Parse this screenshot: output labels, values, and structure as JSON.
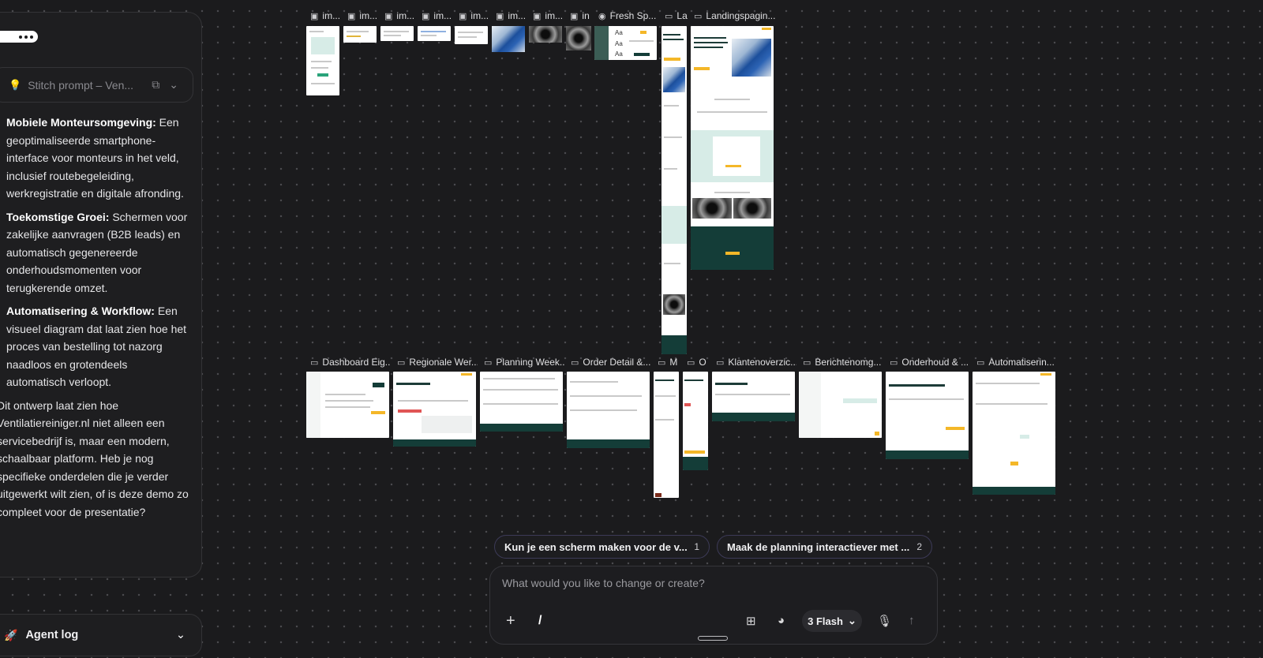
{
  "chat": {
    "prompt_chip": "Stitch prompt – Ven...",
    "paragraphs": [
      {
        "title": "Mobiele Monteursomgeving:",
        "body": " Een geoptimaliseerde smartphone-interface voor monteurs in het veld, inclusief routebegeleiding, werkregistratie en digitale afronding."
      },
      {
        "title": "Toekomstige Groei:",
        "body": " Schermen voor zakelijke aanvragen (B2B leads) en automatisch gegenereerde onderhoudsmomenten voor terugkerende omzet."
      },
      {
        "title": "Automatisering & Workflow:",
        "body": " Een visueel diagram dat laat zien hoe het proces van bestelling tot nazorg naadloos en grotendeels automatisch verloopt."
      }
    ],
    "closing": "Dit ontwerp laat zien hoe Ventilatiereiniger.nl niet alleen een servicebedrijf is, maar een modern, schaalbaar platform. Heb je nog specifieke onderdelen die je verder uitgewerkt wilt zien, of is deze demo zo compleet voor de presentatie?",
    "agent_log": "Agent log"
  },
  "canvas": {
    "top_labels": [
      "im...",
      "im...",
      "im...",
      "im...",
      "im...",
      "im...",
      "im...",
      "in",
      "Fresh Sp...",
      "La",
      "Landingspagin..."
    ],
    "bottom_labels": [
      "Dashboard Eig...",
      "Regionale Wer...",
      "Planning Week...",
      "Order Detail &...",
      "M",
      "O",
      "Klantenoverzic...",
      "Berichtenomg...",
      "Onderhoud & ...",
      "Automatiserin..."
    ]
  },
  "suggestions": [
    {
      "text": "Kun je een scherm maken voor de v...",
      "num": "1"
    },
    {
      "text": "Maak de planning interactiever met ...",
      "num": "2"
    }
  ],
  "composer": {
    "placeholder": "What would you like to change or create?",
    "slash": "/",
    "model": "3 Flash"
  },
  "colors": {
    "accent_dark": "#143d38",
    "accent_yellow": "#f4b728",
    "pill_border": "#3c3a57"
  }
}
